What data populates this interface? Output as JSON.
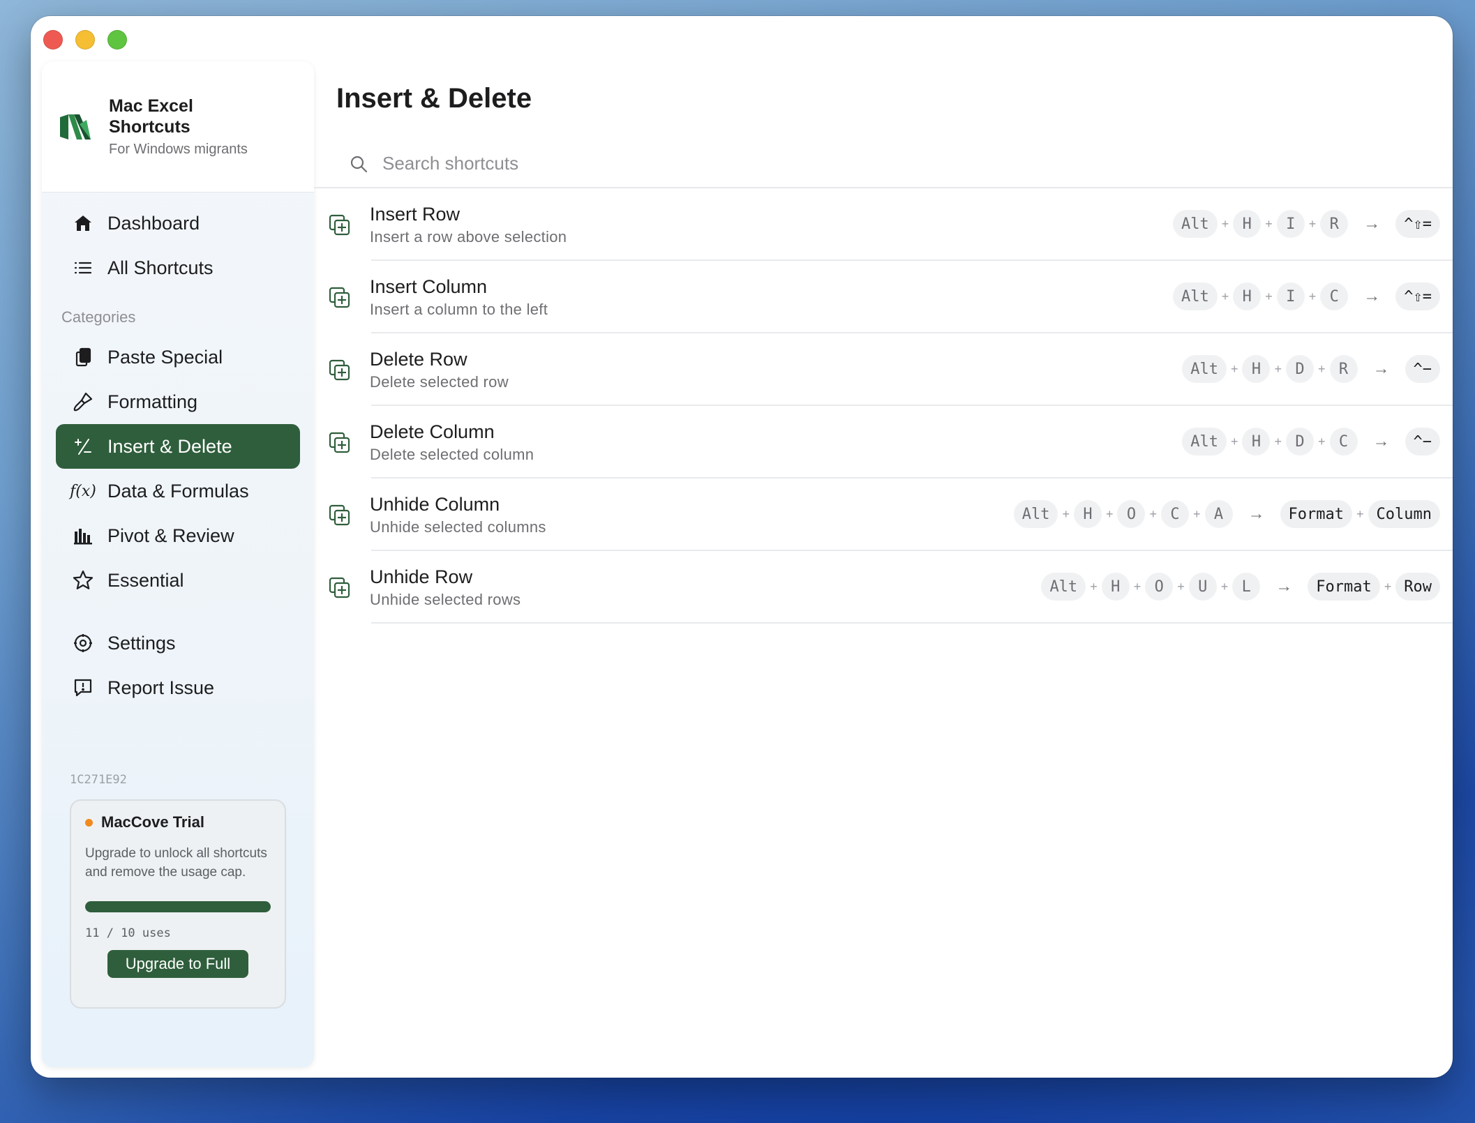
{
  "app": {
    "title": "Mac Excel Shortcuts",
    "subtitle": "For Windows migrants",
    "accent_color": "#2f5e3c"
  },
  "nav": {
    "dashboard": "Dashboard",
    "all_shortcuts": "All Shortcuts",
    "categories_heading": "Categories",
    "categories": [
      {
        "label": "Paste Special",
        "icon": "clipboard-icon"
      },
      {
        "label": "Formatting",
        "icon": "paintbrush-icon"
      },
      {
        "label": "Insert & Delete",
        "icon": "plus-minus-icon",
        "active": true
      },
      {
        "label": "Data & Formulas",
        "icon": "function-icon"
      },
      {
        "label": "Pivot & Review",
        "icon": "bar-chart-icon"
      },
      {
        "label": "Essential",
        "icon": "star-icon"
      }
    ],
    "settings": "Settings",
    "report_issue": "Report Issue"
  },
  "license": {
    "id": "1C271E92",
    "trial_title": "MacCove Trial",
    "trial_body": "Upgrade to unlock all shortcuts and remove the usage cap.",
    "usage_fraction": 1.0,
    "uses_text": "11 / 10 uses",
    "upgrade_button": "Upgrade to Full"
  },
  "main": {
    "title": "Insert & Delete",
    "search_placeholder": "Search shortcuts",
    "shortcuts": [
      {
        "title": "Insert Row",
        "desc": "Insert a row above selection",
        "windows": [
          "Alt",
          "H",
          "I",
          "R"
        ],
        "mac": [
          "^⇧="
        ]
      },
      {
        "title": "Insert Column",
        "desc": "Insert a column to the left",
        "windows": [
          "Alt",
          "H",
          "I",
          "C"
        ],
        "mac": [
          "^⇧="
        ]
      },
      {
        "title": "Delete Row",
        "desc": "Delete selected row",
        "windows": [
          "Alt",
          "H",
          "D",
          "R"
        ],
        "mac": [
          "^−"
        ]
      },
      {
        "title": "Delete Column",
        "desc": "Delete selected column",
        "windows": [
          "Alt",
          "H",
          "D",
          "C"
        ],
        "mac": [
          "^−"
        ]
      },
      {
        "title": "Unhide Column",
        "desc": "Unhide selected columns",
        "windows": [
          "Alt",
          "H",
          "O",
          "C",
          "A"
        ],
        "mac": [
          "Format",
          "Column"
        ]
      },
      {
        "title": "Unhide Row",
        "desc": "Unhide selected rows",
        "windows": [
          "Alt",
          "H",
          "O",
          "U",
          "L"
        ],
        "mac": [
          "Format",
          "Row"
        ]
      }
    ]
  }
}
